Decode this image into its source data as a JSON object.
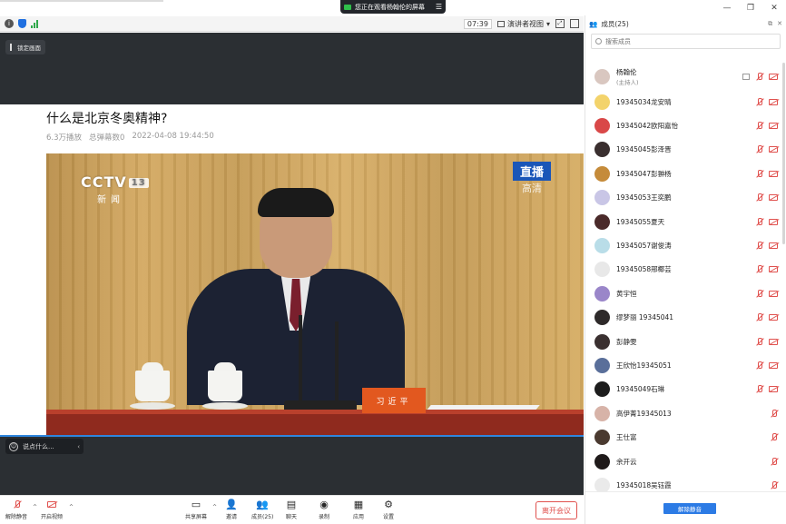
{
  "share_banner": {
    "text": "您正在观看杨翰伦的屏幕"
  },
  "status_bar": {
    "timer": "07:39",
    "view_label": "演讲者视图"
  },
  "stage": {
    "pin_label": "锁定画面"
  },
  "video": {
    "title": "什么是北京冬奥精神?",
    "plays": "6.3万播放",
    "danmaku_count": "总弹幕数0",
    "datetime": "2022-04-08 19:44:50",
    "channel_logo": "CCTV",
    "channel_number": "13",
    "channel_sub": "新闻",
    "live_badge": "直播",
    "hd_badge": "高清",
    "nameplate": "习近平"
  },
  "danmaku": {
    "placeholder": "说点什么..."
  },
  "toolbar": {
    "unmute": "解除静音",
    "video": "开启视频",
    "share": "共享屏幕",
    "invite": "邀请",
    "members": "成员(25)",
    "chat": "聊天",
    "record": "录制",
    "apps": "应用",
    "settings": "设置",
    "leave": "离开会议"
  },
  "panel": {
    "title": "成员(25)",
    "search_placeholder": "搜索成员",
    "unmute_all": "解除静音",
    "members": [
      {
        "name": "杨翰伦",
        "role": "(主持人)",
        "color": "#d9c7c0",
        "host": true
      },
      {
        "name": "19345034龙安晴",
        "color": "#f3d36b"
      },
      {
        "name": "19345042欧阳嘉怡",
        "color": "#d94848"
      },
      {
        "name": "19345045彭泽晋",
        "color": "#3a2f2f"
      },
      {
        "name": "19345047彭翀杨",
        "color": "#c58b3a"
      },
      {
        "name": "19345053王奕鹏",
        "color": "#c9c6e6"
      },
      {
        "name": "19345055夏天",
        "color": "#4a2a2a"
      },
      {
        "name": "19345057谢俊涛",
        "color": "#b9dde8"
      },
      {
        "name": "19345058邢椰芸",
        "color": "#e8e8e8"
      },
      {
        "name": "黄宇恒",
        "color": "#9a86c9"
      },
      {
        "name": "缪梦丽 19345041",
        "color": "#2e2a2a"
      },
      {
        "name": "彭静雯",
        "color": "#3a3030"
      },
      {
        "name": "王欣怡19345051",
        "color": "#5a6f9a"
      },
      {
        "name": "19345049石琳",
        "color": "#1d1d1d"
      },
      {
        "name": "高伊菁19345013",
        "color": "#d7b3a8"
      },
      {
        "name": "王仕富",
        "color": "#4a3a30"
      },
      {
        "name": "余开云",
        "color": "#1f1a1a"
      },
      {
        "name": "19345018吴钰霞",
        "color": "#eaeaea"
      }
    ]
  }
}
